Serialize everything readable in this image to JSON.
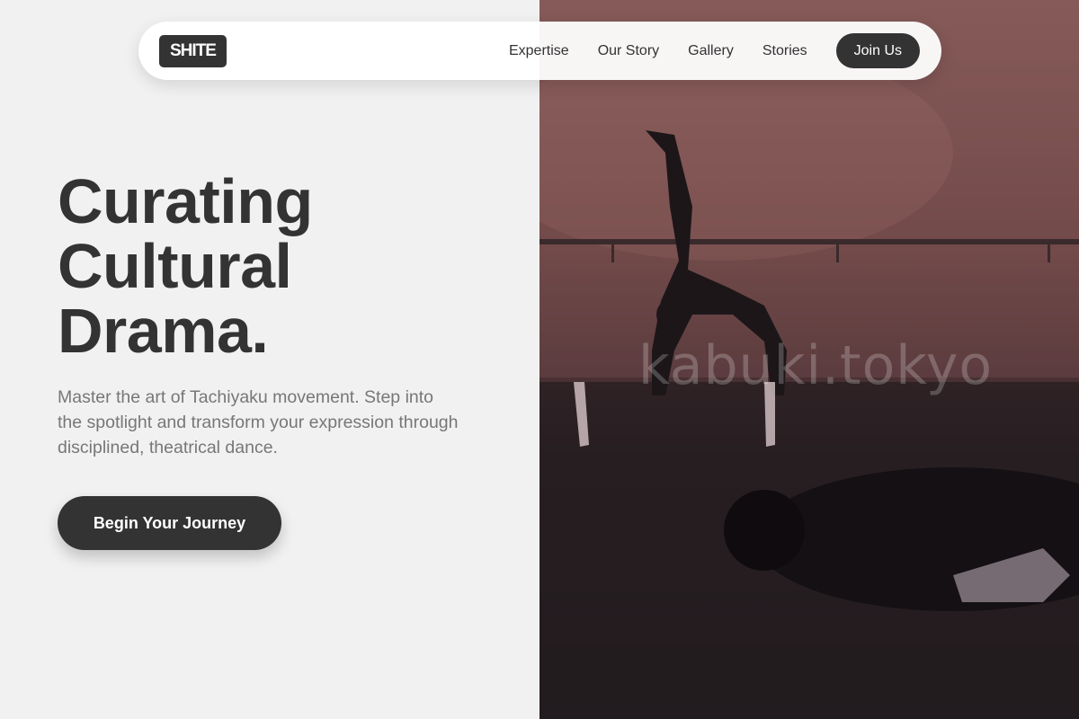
{
  "brand": {
    "logo": "SHITE"
  },
  "nav": {
    "links": [
      "Expertise",
      "Our Story",
      "Gallery",
      "Stories"
    ],
    "cta": "Join Us"
  },
  "hero": {
    "title_lines": [
      "Curating",
      "Cultural",
      "Drama."
    ],
    "description": "Master the art of Tachiyaku movement. Step into the spotlight and transform your expression through disciplined, theatrical dance.",
    "button": "Begin Your Journey",
    "image_watermark": "kabuki.tokyo"
  },
  "colors": {
    "background": "#f1f1f1",
    "dark": "#333333",
    "muted_text": "#777777"
  }
}
